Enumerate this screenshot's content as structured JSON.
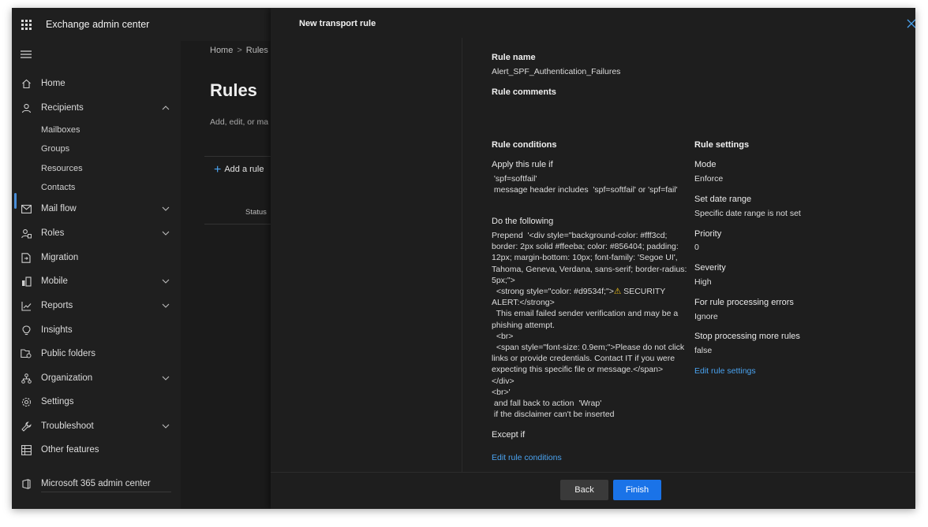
{
  "app": {
    "title": "Exchange admin center"
  },
  "nav": {
    "items": [
      {
        "label": "Home",
        "icon": "home-icon"
      },
      {
        "label": "Recipients",
        "icon": "person-icon",
        "expanded": true,
        "children": [
          "Mailboxes",
          "Groups",
          "Resources",
          "Contacts"
        ]
      },
      {
        "label": "Mail flow",
        "icon": "mail-icon",
        "active": true
      },
      {
        "label": "Roles",
        "icon": "roles-icon"
      },
      {
        "label": "Migration",
        "icon": "migration-icon"
      },
      {
        "label": "Mobile",
        "icon": "mobile-icon"
      },
      {
        "label": "Reports",
        "icon": "reports-icon"
      },
      {
        "label": "Insights",
        "icon": "lightbulb-icon"
      },
      {
        "label": "Public folders",
        "icon": "public-folder-icon"
      },
      {
        "label": "Organization",
        "icon": "organization-icon"
      },
      {
        "label": "Settings",
        "icon": "gear-icon"
      },
      {
        "label": "Troubleshoot",
        "icon": "wrench-icon"
      },
      {
        "label": "Other features",
        "icon": "grid-icon"
      }
    ],
    "bottom": {
      "label": "Microsoft 365 admin center",
      "icon": "office-icon"
    }
  },
  "rules_page": {
    "breadcrumb": [
      "Home",
      "Rules"
    ],
    "title": "Rules",
    "description": "Add, edit, or ma",
    "add_rule": "Add a rule",
    "status_column": "Status"
  },
  "panel": {
    "title": "New transport rule",
    "rule_name_label": "Rule name",
    "rule_name_value": "Alert_SPF_Authentication_Failures",
    "rule_comments_label": "Rule comments",
    "conditions": {
      "heading": "Rule conditions",
      "apply_label": "Apply this rule if",
      "apply_value": " 'spf=softfail'\n message header includes  'spf=softfail' or 'spf=fail'",
      "do_label": "Do the following",
      "do_value_1": "Prepend  '<div style=\"background-color: #fff3cd;\nborder: 2px solid #ffeeba; color: #856404; padding:\n12px; margin-bottom: 10px; font-family: 'Segoe UI',\nTahoma, Geneva, Verdana, sans-serif; border-radius:\n5px;\">\n  <strong style=\"color: #d9534f;\">",
      "warning_glyph": "⚠",
      "do_value_2": " SECURITY",
      "do_value_3": "ALERT:</strong>\n  This email failed sender verification and may be a\nphishing attempt.\n  <br>\n  <span style=\"font-size: 0.9em;\">Please do not click\nlinks or provide credentials. Contact IT if you were\nexpecting this specific file or message.</span>\n</div>\n<br>'\n and fall back to action  'Wrap'\n if the disclaimer can't be inserted",
      "except_label": "Except if",
      "edit_link": "Edit rule conditions"
    },
    "settings": {
      "heading": "Rule settings",
      "mode_label": "Mode",
      "mode_value": "Enforce",
      "date_label": "Set date range",
      "date_value": "Specific date range is not set",
      "priority_label": "Priority",
      "priority_value": "0",
      "severity_label": "Severity",
      "severity_value": "High",
      "errors_label": "For rule processing errors",
      "errors_value": "Ignore",
      "stop_label": "Stop processing more rules",
      "stop_value": "false",
      "edit_link": "Edit rule settings"
    },
    "buttons": {
      "back": "Back",
      "finish": "Finish"
    }
  },
  "colors": {
    "accent": "#1a73e8",
    "link": "#4aa3f0",
    "panel_bg": "#1e1e1e",
    "nav_bg": "#1f1f1f"
  }
}
